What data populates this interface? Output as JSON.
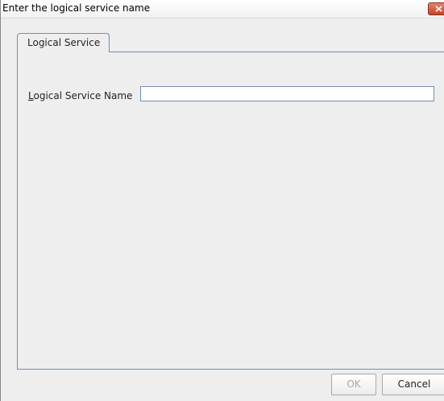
{
  "window": {
    "title": "Enter the logical service name",
    "close_icon": "close-icon"
  },
  "tabs": [
    {
      "label": "Logical Service",
      "selected": true
    }
  ],
  "form": {
    "label_mnemonic": "L",
    "label_rest": "ogical Service Name",
    "value": "",
    "placeholder": ""
  },
  "buttons": {
    "ok_label": "OK",
    "ok_enabled": false,
    "cancel_label": "Cancel"
  },
  "colors": {
    "close_button": "#c7432a",
    "tab_border": "#6f8fb8",
    "disabled_text": "#a8a8a8"
  }
}
